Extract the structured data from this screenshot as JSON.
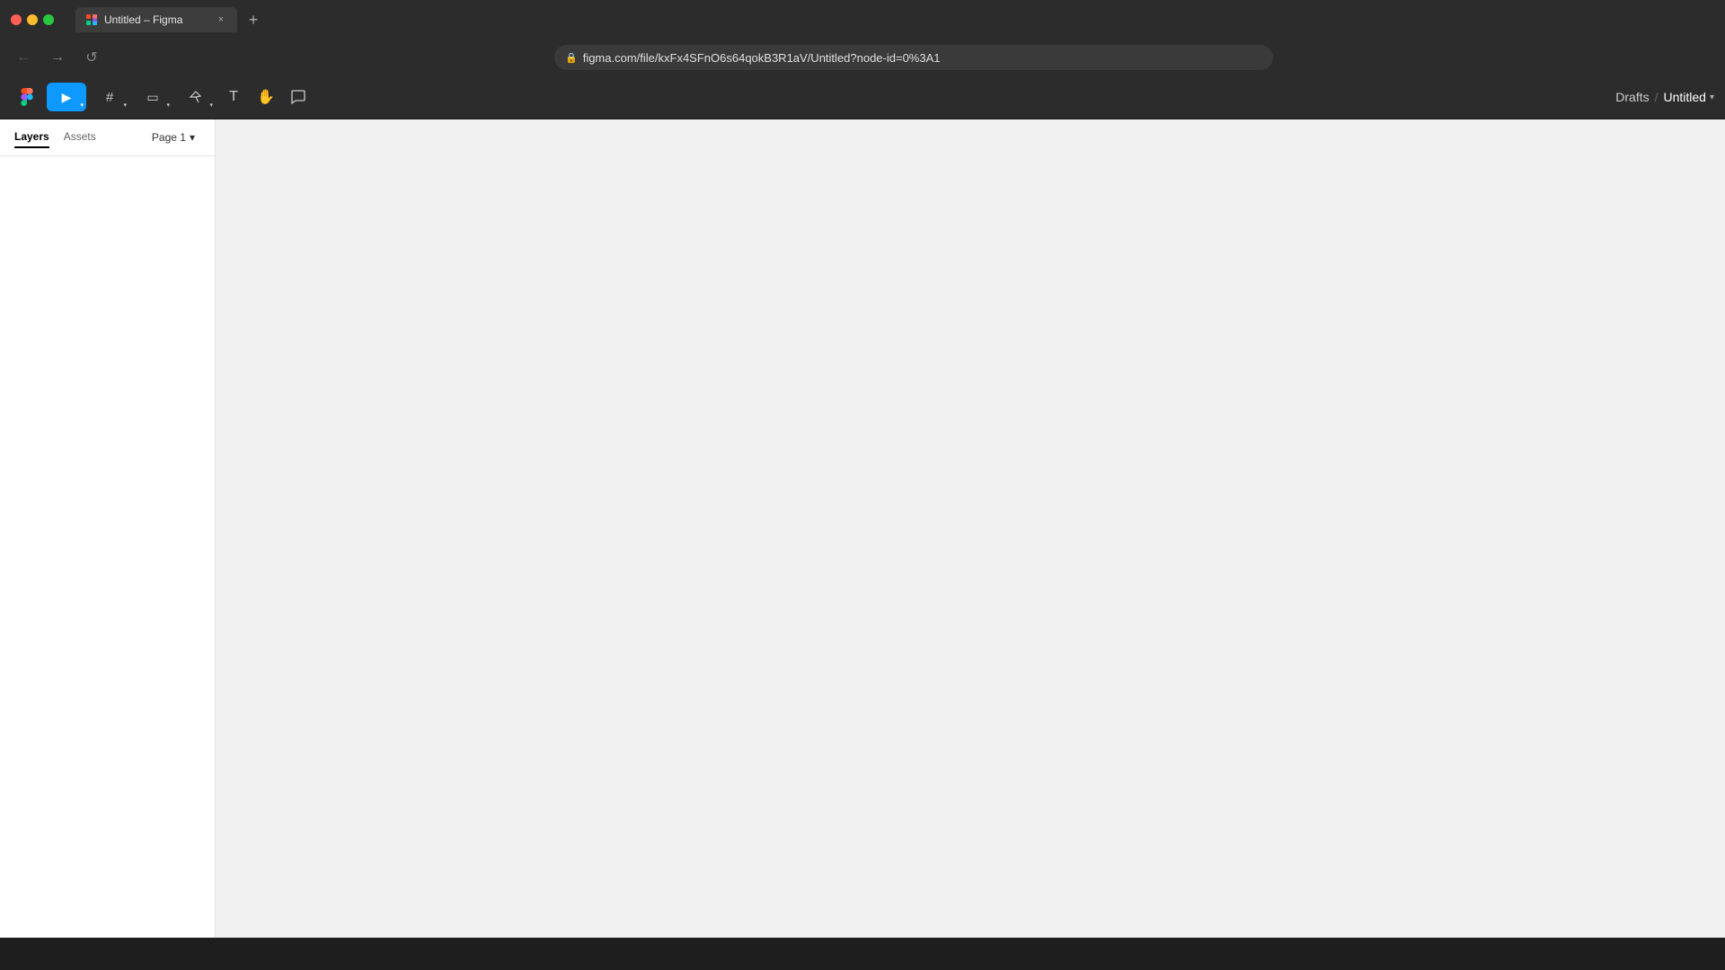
{
  "browser": {
    "traffic_lights": {
      "close_color": "#ff5f57",
      "minimize_color": "#febc2e",
      "maximize_color": "#28c840"
    },
    "tab": {
      "favicon": "figma",
      "title": "Untitled – Figma",
      "close_label": "×"
    },
    "new_tab_label": "+",
    "address_bar": {
      "url": "figma.com/file/kxFx4SFnO6s64qokB3R1aV/Untitled?node-id=0%3A1",
      "lock_icon": "🔒"
    },
    "nav": {
      "back_label": "←",
      "forward_label": "→",
      "refresh_label": "↺"
    }
  },
  "figma": {
    "toolbar": {
      "menu_icon": "⊞",
      "move_tool_label": "▶",
      "move_tool_dropdown": "▾",
      "frame_tool_label": "#",
      "frame_tool_dropdown": "▾",
      "shape_tool_label": "▭",
      "shape_tool_dropdown": "▾",
      "pen_tool_label": "✒",
      "pen_tool_dropdown": "▾",
      "text_tool_label": "T",
      "hand_tool_label": "✋",
      "comment_tool_label": "💬",
      "drafts_label": "Drafts",
      "separator": "/",
      "file_title": "Untitled",
      "chevron_down": "▾"
    },
    "left_panel": {
      "layers_tab": "Layers",
      "assets_tab": "Assets",
      "page_label": "Page 1",
      "page_chevron": "▾"
    },
    "canvas": {
      "background_color": "#f0f0f0"
    }
  }
}
